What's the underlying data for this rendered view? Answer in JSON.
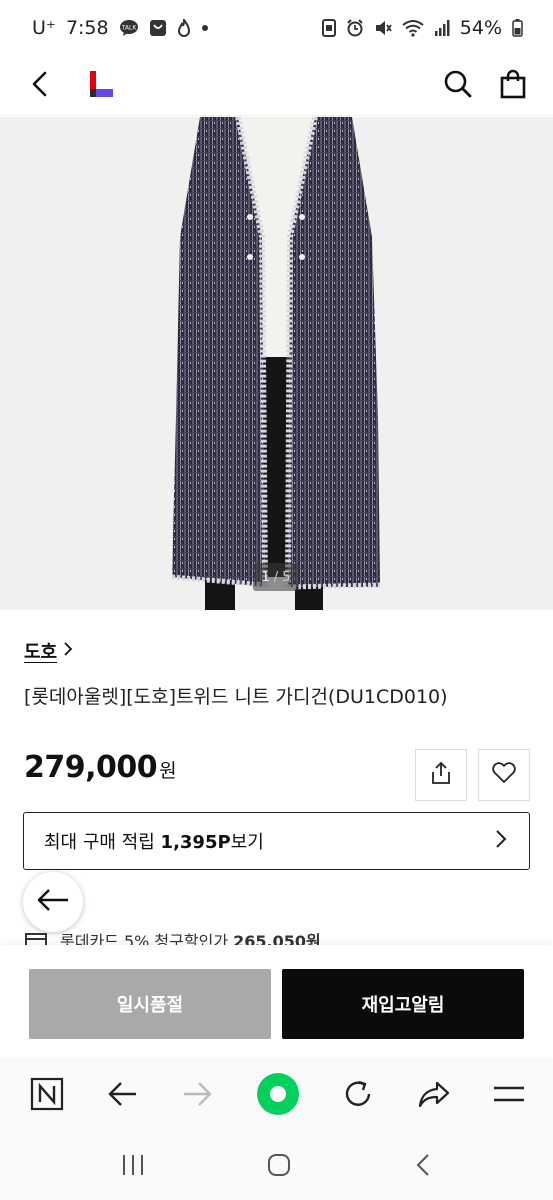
{
  "status_bar": {
    "carrier": "U⁺",
    "time": "7:58",
    "battery_percent": "54%",
    "left_icons": [
      "talk-icon",
      "bag-icon",
      "flame-icon",
      "dot-icon"
    ],
    "right_icons": [
      "screenshot-icon",
      "alarm-icon",
      "mute-icon",
      "wifi-icon",
      "signal-icon",
      "battery-icon"
    ]
  },
  "app_bar": {
    "icons": [
      "back-icon",
      "lotte-logo",
      "search-icon",
      "shopping-bag-icon"
    ]
  },
  "gallery": {
    "current": "1",
    "separator": "/",
    "total": "5"
  },
  "product": {
    "brand": "도호",
    "title": "[롯데아울렛][도호]트위드 니트 가디건(DU1CD010)",
    "price": "279,000",
    "price_unit": "원"
  },
  "points": {
    "prefix": "최대 구매 적립",
    "amount": "1,395P",
    "suffix": "보기"
  },
  "card_discount": {
    "text": "롯데카드 5% 청구할인가",
    "price": "265,050원"
  },
  "actions": {
    "soldout_label": "일시품절",
    "notify_label": "재입고알림"
  },
  "colors": {
    "soldout_bg": "#a9a9a9",
    "notify_bg": "#0b0b0b",
    "naver_green": "#03cf5d",
    "lotte_red": "#e60012",
    "lotte_purple": "#6b46e0"
  }
}
